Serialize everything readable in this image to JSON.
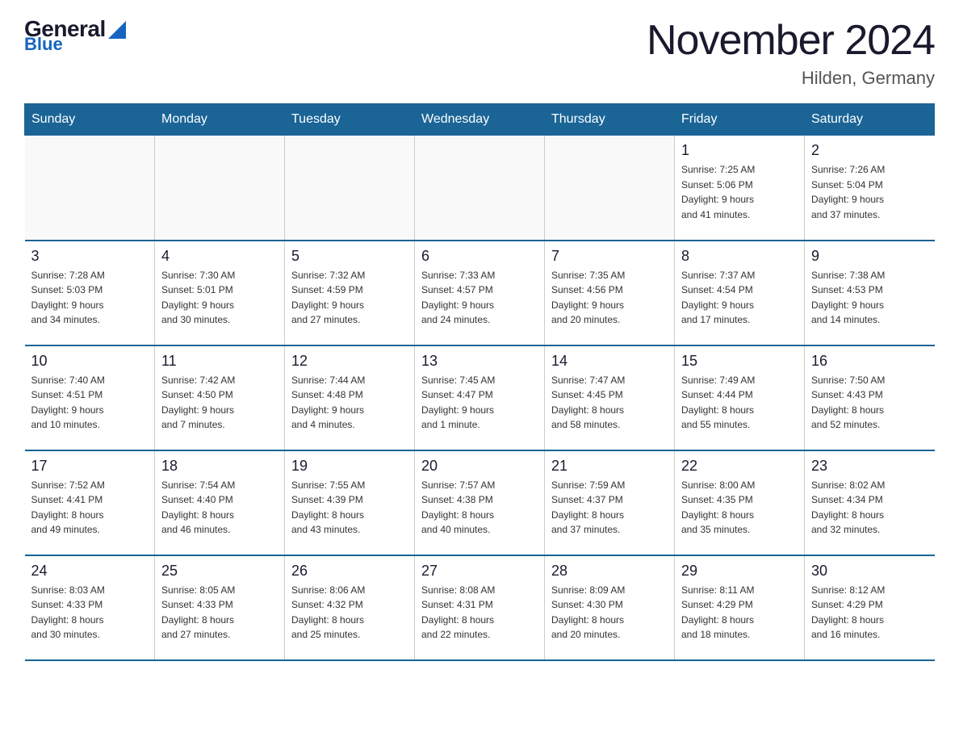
{
  "header": {
    "logo_general": "General",
    "logo_blue": "Blue",
    "title": "November 2024",
    "subtitle": "Hilden, Germany"
  },
  "weekdays": [
    "Sunday",
    "Monday",
    "Tuesday",
    "Wednesday",
    "Thursday",
    "Friday",
    "Saturday"
  ],
  "weeks": [
    {
      "days": [
        {
          "number": "",
          "info": "",
          "empty": true
        },
        {
          "number": "",
          "info": "",
          "empty": true
        },
        {
          "number": "",
          "info": "",
          "empty": true
        },
        {
          "number": "",
          "info": "",
          "empty": true
        },
        {
          "number": "",
          "info": "",
          "empty": true
        },
        {
          "number": "1",
          "info": "Sunrise: 7:25 AM\nSunset: 5:06 PM\nDaylight: 9 hours\nand 41 minutes."
        },
        {
          "number": "2",
          "info": "Sunrise: 7:26 AM\nSunset: 5:04 PM\nDaylight: 9 hours\nand 37 minutes."
        }
      ]
    },
    {
      "days": [
        {
          "number": "3",
          "info": "Sunrise: 7:28 AM\nSunset: 5:03 PM\nDaylight: 9 hours\nand 34 minutes."
        },
        {
          "number": "4",
          "info": "Sunrise: 7:30 AM\nSunset: 5:01 PM\nDaylight: 9 hours\nand 30 minutes."
        },
        {
          "number": "5",
          "info": "Sunrise: 7:32 AM\nSunset: 4:59 PM\nDaylight: 9 hours\nand 27 minutes."
        },
        {
          "number": "6",
          "info": "Sunrise: 7:33 AM\nSunset: 4:57 PM\nDaylight: 9 hours\nand 24 minutes."
        },
        {
          "number": "7",
          "info": "Sunrise: 7:35 AM\nSunset: 4:56 PM\nDaylight: 9 hours\nand 20 minutes."
        },
        {
          "number": "8",
          "info": "Sunrise: 7:37 AM\nSunset: 4:54 PM\nDaylight: 9 hours\nand 17 minutes."
        },
        {
          "number": "9",
          "info": "Sunrise: 7:38 AM\nSunset: 4:53 PM\nDaylight: 9 hours\nand 14 minutes."
        }
      ]
    },
    {
      "days": [
        {
          "number": "10",
          "info": "Sunrise: 7:40 AM\nSunset: 4:51 PM\nDaylight: 9 hours\nand 10 minutes."
        },
        {
          "number": "11",
          "info": "Sunrise: 7:42 AM\nSunset: 4:50 PM\nDaylight: 9 hours\nand 7 minutes."
        },
        {
          "number": "12",
          "info": "Sunrise: 7:44 AM\nSunset: 4:48 PM\nDaylight: 9 hours\nand 4 minutes."
        },
        {
          "number": "13",
          "info": "Sunrise: 7:45 AM\nSunset: 4:47 PM\nDaylight: 9 hours\nand 1 minute."
        },
        {
          "number": "14",
          "info": "Sunrise: 7:47 AM\nSunset: 4:45 PM\nDaylight: 8 hours\nand 58 minutes."
        },
        {
          "number": "15",
          "info": "Sunrise: 7:49 AM\nSunset: 4:44 PM\nDaylight: 8 hours\nand 55 minutes."
        },
        {
          "number": "16",
          "info": "Sunrise: 7:50 AM\nSunset: 4:43 PM\nDaylight: 8 hours\nand 52 minutes."
        }
      ]
    },
    {
      "days": [
        {
          "number": "17",
          "info": "Sunrise: 7:52 AM\nSunset: 4:41 PM\nDaylight: 8 hours\nand 49 minutes."
        },
        {
          "number": "18",
          "info": "Sunrise: 7:54 AM\nSunset: 4:40 PM\nDaylight: 8 hours\nand 46 minutes."
        },
        {
          "number": "19",
          "info": "Sunrise: 7:55 AM\nSunset: 4:39 PM\nDaylight: 8 hours\nand 43 minutes."
        },
        {
          "number": "20",
          "info": "Sunrise: 7:57 AM\nSunset: 4:38 PM\nDaylight: 8 hours\nand 40 minutes."
        },
        {
          "number": "21",
          "info": "Sunrise: 7:59 AM\nSunset: 4:37 PM\nDaylight: 8 hours\nand 37 minutes."
        },
        {
          "number": "22",
          "info": "Sunrise: 8:00 AM\nSunset: 4:35 PM\nDaylight: 8 hours\nand 35 minutes."
        },
        {
          "number": "23",
          "info": "Sunrise: 8:02 AM\nSunset: 4:34 PM\nDaylight: 8 hours\nand 32 minutes."
        }
      ]
    },
    {
      "days": [
        {
          "number": "24",
          "info": "Sunrise: 8:03 AM\nSunset: 4:33 PM\nDaylight: 8 hours\nand 30 minutes."
        },
        {
          "number": "25",
          "info": "Sunrise: 8:05 AM\nSunset: 4:33 PM\nDaylight: 8 hours\nand 27 minutes."
        },
        {
          "number": "26",
          "info": "Sunrise: 8:06 AM\nSunset: 4:32 PM\nDaylight: 8 hours\nand 25 minutes."
        },
        {
          "number": "27",
          "info": "Sunrise: 8:08 AM\nSunset: 4:31 PM\nDaylight: 8 hours\nand 22 minutes."
        },
        {
          "number": "28",
          "info": "Sunrise: 8:09 AM\nSunset: 4:30 PM\nDaylight: 8 hours\nand 20 minutes."
        },
        {
          "number": "29",
          "info": "Sunrise: 8:11 AM\nSunset: 4:29 PM\nDaylight: 8 hours\nand 18 minutes."
        },
        {
          "number": "30",
          "info": "Sunrise: 8:12 AM\nSunset: 4:29 PM\nDaylight: 8 hours\nand 16 minutes."
        }
      ]
    }
  ]
}
